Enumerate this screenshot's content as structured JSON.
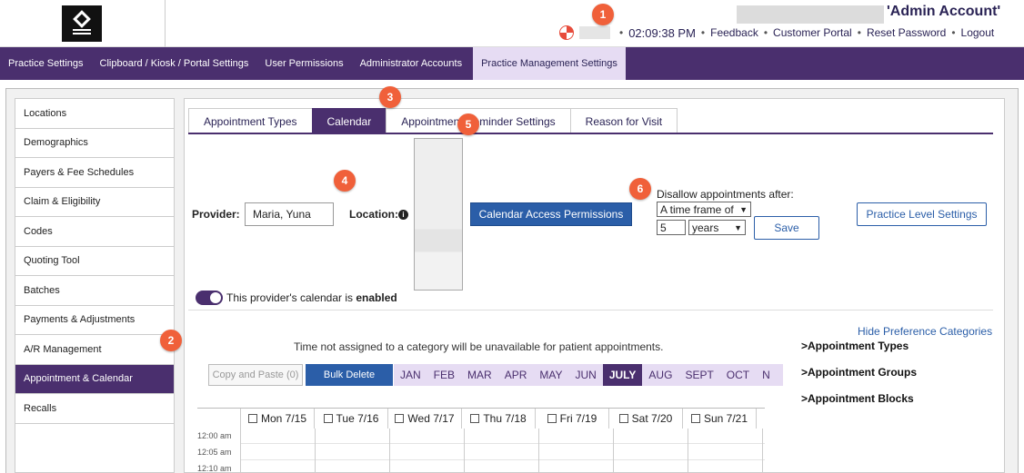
{
  "header": {
    "account_title": "'Admin Account'",
    "clock": "02:09:38 PM",
    "links": [
      "Feedback",
      "Customer Portal",
      "Reset Password",
      "Logout"
    ],
    "separator": "•"
  },
  "topnav": {
    "items": [
      "Practice Settings",
      "Clipboard / Kiosk / Portal Settings",
      "User Permissions",
      "Administrator Accounts",
      "Practice Management Settings"
    ],
    "active_index": 4
  },
  "sidebar": {
    "items": [
      "Locations",
      "Demographics",
      "Payers & Fee Schedules",
      "Claim & Eligibility",
      "Codes",
      "Quoting Tool",
      "Batches",
      "Payments & Adjustments",
      "A/R Management",
      "Appointment & Calendar",
      "Recalls"
    ],
    "active_index": 9
  },
  "tabs": {
    "items": [
      "Appointment Types",
      "Calendar",
      "Appointment Reminder Settings",
      "Reason for Visit"
    ],
    "active_index": 1
  },
  "form": {
    "provider_label": "Provider:",
    "provider_value": "Maria, Yuna",
    "location_label": "Location:",
    "calendar_access_button": "Calendar Access Permissions",
    "disallow_label": "Disallow appointments after:",
    "timeframe_select": "A time frame of",
    "amount_value": "5",
    "unit_select": "years",
    "save_button": "Save",
    "practice_level_button": "Practice Level Settings"
  },
  "toggle": {
    "prefix": "This provider's calendar is ",
    "state": "enabled"
  },
  "calendar": {
    "info_text": "Time not assigned to a category will be unavailable for patient appointments.",
    "copy_paste_button": "Copy and Paste (0)",
    "bulk_delete_button": "Bulk Delete",
    "months": [
      "JAN",
      "FEB",
      "MAR",
      "APR",
      "MAY",
      "JUN",
      "JULY",
      "AUG",
      "SEPT",
      "OCT",
      "N"
    ],
    "active_month_index": 6,
    "days": [
      "Mon 7/15",
      "Tue 7/16",
      "Wed 7/17",
      "Thu 7/18",
      "Fri 7/19",
      "Sat 7/20",
      "Sun 7/21"
    ],
    "times": [
      "12:00 am",
      "12:05 am",
      "12:10 am"
    ]
  },
  "preferences": {
    "hide_link": "Hide Preference Categories",
    "categories": [
      "Appointment Types",
      "Appointment Groups",
      "Appointment Blocks"
    ],
    "chevron": ">"
  },
  "steps": [
    "1",
    "2",
    "3",
    "4",
    "5",
    "6"
  ],
  "colors": {
    "brand_purple": "#4a2f6e",
    "light_purple": "#e6dcf3",
    "primary_blue": "#2b5ea8",
    "step_badge": "#f0603a"
  }
}
